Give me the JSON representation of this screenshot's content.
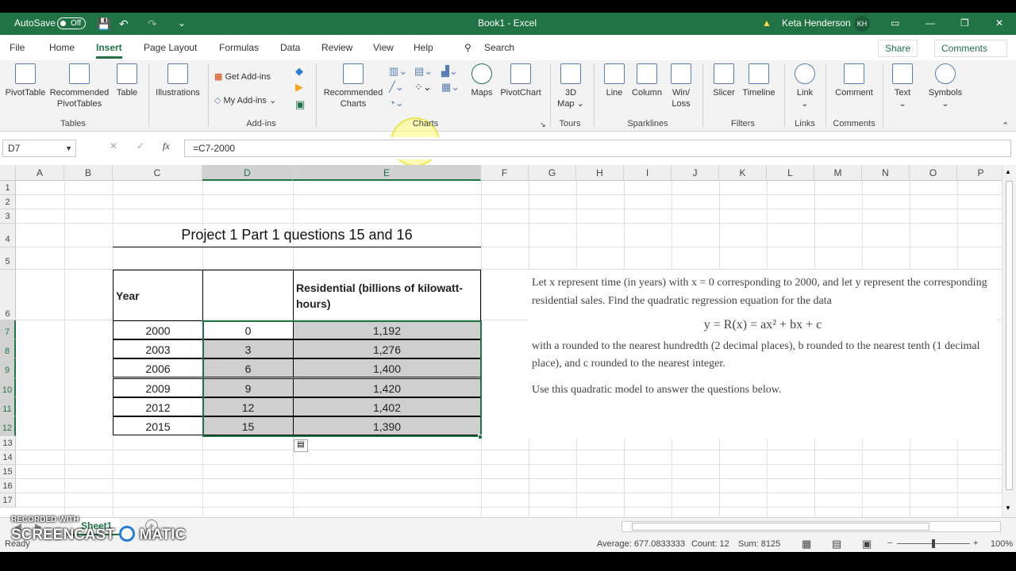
{
  "app": {
    "autosave_label": "AutoSave",
    "autosave_state": "Off",
    "title": "Book1 - Excel",
    "user_name": "Keta Henderson",
    "user_initials": "KH"
  },
  "tabs": [
    "File",
    "Home",
    "Insert",
    "Page Layout",
    "Formulas",
    "Data",
    "Review",
    "View",
    "Help"
  ],
  "active_tab": "Insert",
  "search_label": "Search",
  "share_label": "Share",
  "comments_label": "Comments",
  "ribbon": {
    "pivottable": "PivotTable",
    "recommended_pivottables_1": "Recommended",
    "recommended_pivottables_2": "PivotTables",
    "table": "Table",
    "group_tables": "Tables",
    "illustrations": "Illustrations",
    "get_addins": "Get Add-ins",
    "my_addins": "My Add-ins",
    "group_addins": "Add-ins",
    "recommended_charts_1": "Recommended",
    "recommended_charts_2": "Charts",
    "maps": "Maps",
    "pivotchart": "PivotChart",
    "group_charts": "Charts",
    "map3d_1": "3D",
    "map3d_2": "Map",
    "group_tours": "Tours",
    "line": "Line",
    "column": "Column",
    "winloss_1": "Win/",
    "winloss_2": "Loss",
    "group_sparklines": "Sparklines",
    "slicer": "Slicer",
    "timeline": "Timeline",
    "group_filters": "Filters",
    "link": "Link",
    "group_links": "Links",
    "comment": "Comment",
    "group_comments": "Comments",
    "text": "Text",
    "symbols": "Symbols"
  },
  "formula_bar": {
    "name_box": "D7",
    "formula": "=C7-2000"
  },
  "columns": [
    "A",
    "B",
    "C",
    "D",
    "E",
    "F",
    "G",
    "H",
    "I",
    "J",
    "K",
    "L",
    "M",
    "N",
    "O",
    "P"
  ],
  "rows": [
    "1",
    "2",
    "3",
    "4",
    "5",
    "6",
    "7",
    "8",
    "9",
    "10",
    "11",
    "12",
    "13",
    "14",
    "15",
    "16",
    "17"
  ],
  "sheet": {
    "title": "Project 1 Part 1 questions 15 and 16",
    "header_year": "Year",
    "header_residential": "Residential (billions of kilowatt-hours)",
    "years": [
      "2000",
      "2003",
      "2006",
      "2009",
      "2012",
      "2015"
    ],
    "x_values": [
      "0",
      "3",
      "6",
      "9",
      "12",
      "15"
    ],
    "residential": [
      "1,192",
      "1,276",
      "1,400",
      "1,420",
      "1,402",
      "1,390"
    ]
  },
  "problem_text": {
    "p1": "Let x represent time (in years) with x = 0 corresponding to 2000, and let y represent the corresponding residential sales. Find the quadratic regression equation for the data",
    "equation": "y = R(x) = ax² + bx + c",
    "p2": "with a rounded to the nearest hundredth (2 decimal places), b rounded to the nearest tenth (1 decimal place), and c rounded to the nearest integer.",
    "p3": "Use this quadratic model to answer the questions below."
  },
  "sheet_tab": "Sheet1",
  "status": {
    "ready": "Ready",
    "average": "Average: 677.0833333",
    "count": "Count: 12",
    "sum": "Sum: 8125",
    "zoom": "100%"
  },
  "watermark_1": "RECORDED WITH",
  "watermark_2": "SCREENCAST",
  "watermark_3": "MATIC"
}
